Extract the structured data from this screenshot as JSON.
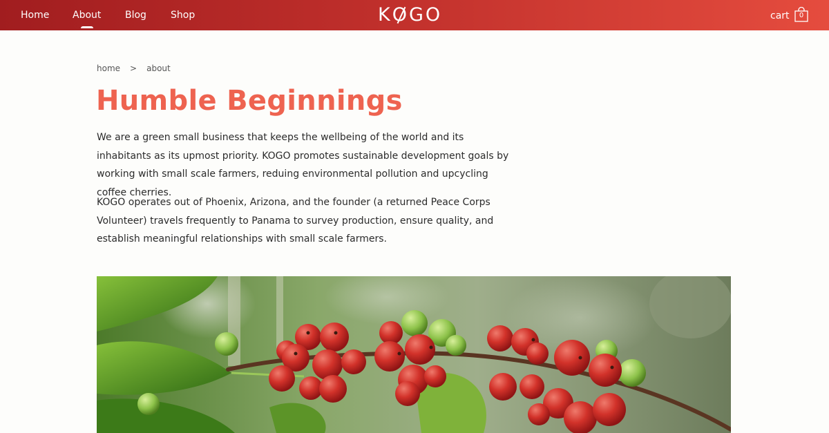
{
  "nav": {
    "links": [
      "Home",
      "About",
      "Blog",
      "Shop"
    ],
    "active": "About",
    "logo_text": "KOGO",
    "cart_label": "cart",
    "cart_count": "0"
  },
  "breadcrumb": {
    "home": "home",
    "separator": ">",
    "current": "about"
  },
  "main": {
    "title": "Humble Beginnings",
    "paragraph1": "We are a green small business that keeps the wellbeing of the world and its inhabitants as its upmost priority. KOGO promotes sustainable development goals by working with small scale farmers, reduing environmental pollution and upcycling coffee cherries.",
    "paragraph2": "KOGO operates out of Phoenix, Arizona, and the founder (a returned Peace Corps Volunteer) travels frequently to Panama to survey production, ensure quality, and establish meaningful relationships with small scale farmers."
  },
  "colors": {
    "nav_start": "#a11d1f",
    "nav_end": "#e54c3e",
    "title": "#ee6350",
    "body_text": "#2b2b2b",
    "background": "#fdfdfb"
  },
  "hero": {
    "image": "coffee-cherries-photo"
  }
}
